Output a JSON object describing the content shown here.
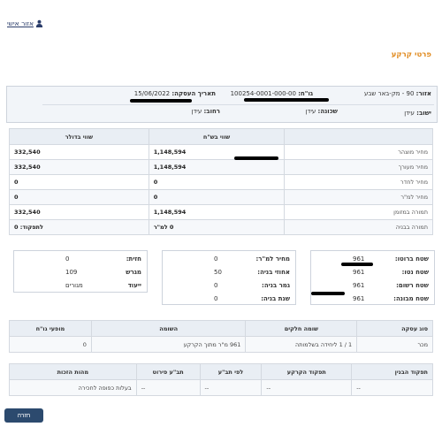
{
  "header": {
    "personal_area": "אזור אישי",
    "person_icon": "person-icon"
  },
  "section_title": "פרטי קרקע",
  "info": {
    "area_label": "אזור:",
    "area_value": "90 - מק-באר שבע",
    "block_label": "גו\"ח:",
    "block_value": "100254-0001-000-00",
    "deal_date_label": "תאריך העסקה:",
    "deal_date_value": "15/06/2022",
    "settlement_label": "ישוב:",
    "settlement_value": "עידן",
    "neighborhood_label": "שכונה:",
    "neighborhood_value": "עידן",
    "street_label": "רחוב:",
    "street_value": "עידן"
  },
  "values_table": {
    "headers": [
      "",
      "שווי בש\"ח",
      "שווי בדולר"
    ],
    "rows": [
      [
        "מחיר מוצהר",
        "1,148,594",
        "332,540"
      ],
      [
        "מחיר מעורך",
        "1,148,594",
        "332,540"
      ],
      [
        "מחיר לחדר",
        "0",
        "0"
      ],
      [
        "מחיר למ\"ר",
        "0",
        "0"
      ],
      [
        "תמורה במזומן",
        "1,148,594",
        "332,540"
      ],
      [
        "תמורה בבניה",
        "0 למ\"ר",
        "לתפקוד: 0"
      ]
    ]
  },
  "details_right": [
    [
      "שטח ברוטו:",
      "961"
    ],
    [
      "שטח נטו:",
      "961"
    ],
    [
      "שטח רשום:",
      "961"
    ],
    [
      "שטח מבונה:",
      "961"
    ]
  ],
  "details_middle": [
    [
      "מחיר למ\"ר:",
      "0"
    ],
    [
      "אחוזי בניה:",
      "50"
    ],
    [
      "גמר בניה:",
      "0"
    ],
    [
      "שנת בניה:",
      "0"
    ]
  ],
  "details_left": [
    [
      "חזית:",
      "0"
    ],
    [
      "מגרש",
      "109"
    ],
    [
      "ייעוד",
      "מגורים"
    ]
  ],
  "deal_table": {
    "headers": [
      "סוג עסקה",
      "שומה חלקים",
      "השומה",
      "מופעי גו\"ח"
    ],
    "row": [
      "מכר",
      "1 / 1 ליחידה בשלמותה",
      "961 מ\"ר מתוך הקרקע",
      "0"
    ]
  },
  "building_table": {
    "headers": [
      "תפקוד הבנין",
      "תפקוד הקרקע",
      "לפי תב\"ע",
      "תב\"ע פירוט",
      "מהות הזכות"
    ],
    "row": [
      "--",
      "--",
      "--",
      "--",
      "בעלות כפופה לחכירה"
    ]
  },
  "back_button": "חזרה"
}
